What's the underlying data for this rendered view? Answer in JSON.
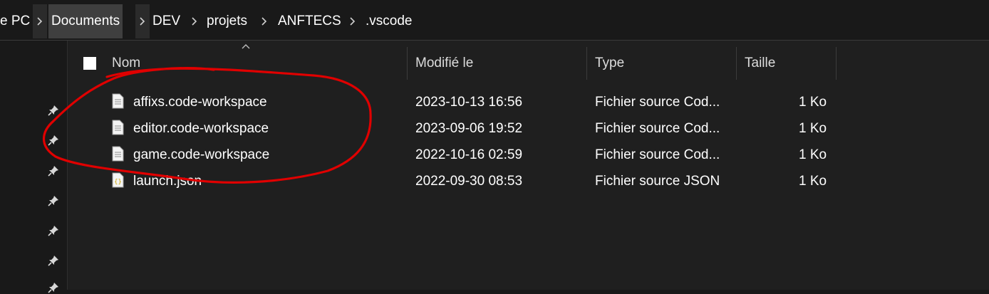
{
  "breadcrumb": {
    "items": [
      {
        "label": "e PC"
      },
      {
        "label": "Documents"
      },
      {
        "label": "DEV"
      },
      {
        "label": "projets"
      },
      {
        "label": "ANFTECS"
      },
      {
        "label": ".vscode"
      }
    ]
  },
  "columns": {
    "name": "Nom",
    "modified": "Modifié le",
    "type": "Type",
    "size": "Taille"
  },
  "files": [
    {
      "name": "affixs.code-workspace",
      "modified": "2023-10-13 16:56",
      "type": "Fichier source Cod...",
      "size": "1 Ko",
      "icon": "document-icon"
    },
    {
      "name": "editor.code-workspace",
      "modified": "2023-09-06 19:52",
      "type": "Fichier source Cod...",
      "size": "1 Ko",
      "icon": "document-icon"
    },
    {
      "name": "game.code-workspace",
      "modified": "2022-10-16 02:59",
      "type": "Fichier source Cod...",
      "size": "1 Ko",
      "icon": "document-icon"
    },
    {
      "name": "launch.json",
      "modified": "2022-09-30 08:53",
      "type": "Fichier source JSON",
      "size": "1 Ko",
      "icon": "json-file-icon"
    }
  ],
  "colors": {
    "background": "#1f1f1f",
    "active_crumb": "#3f3f3f",
    "annotation": "#e00000"
  }
}
